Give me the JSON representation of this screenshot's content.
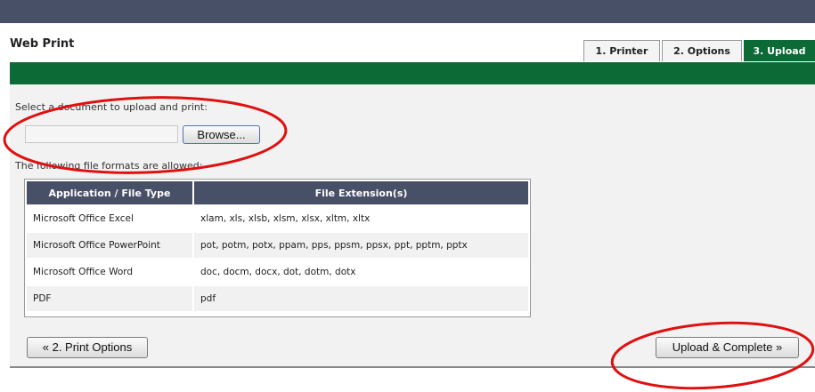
{
  "page": {
    "title": "Web Print"
  },
  "steps": [
    {
      "label": "1. Printer"
    },
    {
      "label": "2. Options"
    },
    {
      "label": "3. Upload"
    }
  ],
  "upload": {
    "instruction": "Select a document to upload and print:",
    "file_value": "",
    "browse_label": "Browse...",
    "formats_intro": "The following file formats are allowed:"
  },
  "formats": {
    "headers": [
      "Application / File Type",
      "File Extension(s)"
    ],
    "rows": [
      {
        "app": "Microsoft Office Excel",
        "ext": "xlam, xls, xlsb, xlsm, xlsx, xltm, xltx"
      },
      {
        "app": "Microsoft Office PowerPoint",
        "ext": "pot, potm, potx, ppam, pps, ppsm, ppsx, ppt, pptm, pptx"
      },
      {
        "app": "Microsoft Office Word",
        "ext": "doc, docm, docx, dot, dotm, dotx"
      },
      {
        "app": "PDF",
        "ext": "pdf"
      }
    ]
  },
  "nav": {
    "prev_label": "« 2. Print Options",
    "next_label": "Upload & Complete »"
  },
  "colors": {
    "header_bar": "#485068",
    "brand_green": "#0b6a35",
    "annotation_red": "#e01010"
  }
}
